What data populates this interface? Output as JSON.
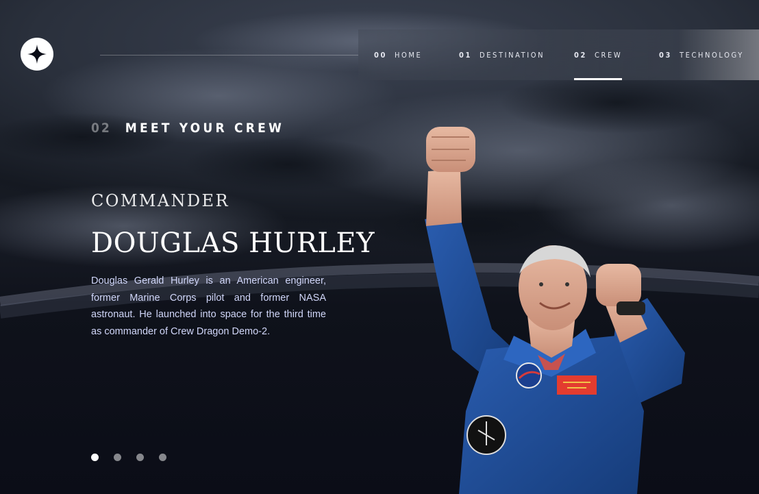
{
  "header": {
    "logo_icon": "star-logo-icon",
    "nav": [
      {
        "num": "00",
        "label": "HOME",
        "active": false
      },
      {
        "num": "01",
        "label": "DESTINATION",
        "active": false
      },
      {
        "num": "02",
        "label": "CREW",
        "active": true
      },
      {
        "num": "03",
        "label": "TECHNOLOGY",
        "active": false
      }
    ]
  },
  "page": {
    "number": "02",
    "title": "MEET YOUR CREW"
  },
  "crew": {
    "role": "COMMANDER",
    "name": "DOUGLAS HURLEY",
    "bio": "Douglas Gerald Hurley is an American engineer, former Marine Corps pilot and former NASA astronaut. He launched into space for the third time as commander of Crew Dragon Demo-2.",
    "image_icon": "astronaut-photo",
    "slider": {
      "count": 4,
      "active_index": 0
    }
  },
  "colors": {
    "background": "#0b0d17",
    "text": "#ffffff",
    "body_text": "#d0d6f9",
    "suit_blue": "#1f4e9c"
  }
}
